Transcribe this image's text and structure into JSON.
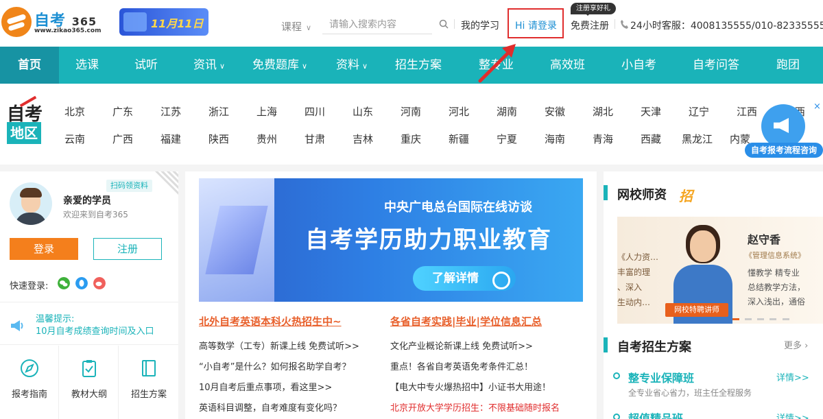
{
  "logo": {
    "name": "自考",
    "num": "365",
    "url": "www.zikao365.com"
  },
  "promo": {
    "text": "11月11日"
  },
  "search": {
    "course_label": "课程",
    "placeholder": "请输入搜索内容"
  },
  "topbar": {
    "my_study": "我的学习",
    "login": "Hi 请登录",
    "register_gift": "注册享好礼",
    "register": "免费注册",
    "hotline": "24小时客服：4008135555/010-82335555"
  },
  "nav": [
    "首页",
    "选课",
    "试听",
    "资讯",
    "免费题库",
    "资料",
    "招生方案",
    "整专业",
    "高效班",
    "小自考",
    "自考问答",
    "跑团"
  ],
  "region": {
    "badge_top": "自考",
    "badge_bottom": "地区",
    "row1": [
      "北京",
      "广东",
      "江苏",
      "浙江",
      "上海",
      "四川",
      "山东",
      "河南",
      "河北",
      "湖南",
      "安徽",
      "湖北",
      "天津",
      "辽宁",
      "江西",
      "山西"
    ],
    "row2": [
      "云南",
      "广西",
      "福建",
      "陕西",
      "贵州",
      "甘肃",
      "吉林",
      "重庆",
      "新疆",
      "宁夏",
      "海南",
      "青海",
      "西藏",
      "黑龙江",
      "内蒙"
    ],
    "consult": "自考报考流程咨询",
    "close": "×"
  },
  "left": {
    "qr_tag": "扫码领资料",
    "hello": "亲爱的学员",
    "welcome": "欢迎来到自考365",
    "login": "登录",
    "register": "注册",
    "quick_login": "快速登录:",
    "tip_title": "温馨提示:",
    "tip_text": "10月自考成绩查询时间及入口",
    "tools": [
      "报考指南",
      "教材大纲",
      "招生方案"
    ]
  },
  "banner": {
    "sub": "中央广电总台国际在线访谈",
    "title": "自考学历助力职业教育",
    "button": "了解详情"
  },
  "news": {
    "col1_head": "北外自考英语本科火热招生中~",
    "col1": [
      "高等数学（工专）新课上线 免费试听>>",
      "“小自考”是什么？如何报名助学自考？",
      "10月自考后重点事项，看这里>>",
      "英语科目调整，自考难度有变化吗？"
    ],
    "col2_head": "各省自考实践|毕业|学位信息汇总",
    "col2": [
      "文化产业概论新课上线 免费试听>>",
      "重点！各省自考英语免考条件汇总！",
      "【电大中专火爆热招中】小证书大用途！",
      "北京开放大学学历招生：不限基础随时报名"
    ]
  },
  "right": {
    "teachers_title": "网校师资",
    "zhao": "招",
    "teacher_name": "赵守香",
    "teacher_course": "《管理信息系统》",
    "teacher_desc": [
      "懂教学 精专业",
      "总结教学方法，",
      "深入浅出，通俗"
    ],
    "teacher_left": [
      "《人力资…",
      "丰富的理",
      "、深入",
      "生动内…"
    ],
    "teacher_tag": "网校特聘讲师",
    "plans_title": "自考招生方案",
    "more": "更多",
    "plans": [
      {
        "title": "整专业保障班",
        "desc": "全专业省心省力，班主任全程服务",
        "more": "详情>>"
      },
      {
        "title": "超值精品班",
        "desc": "",
        "more": "详情>>"
      }
    ]
  },
  "colors": {
    "teal": "#1ab3b9",
    "orange": "#f47f1c",
    "red": "#e02d2d",
    "blue": "#1c8fd3"
  }
}
